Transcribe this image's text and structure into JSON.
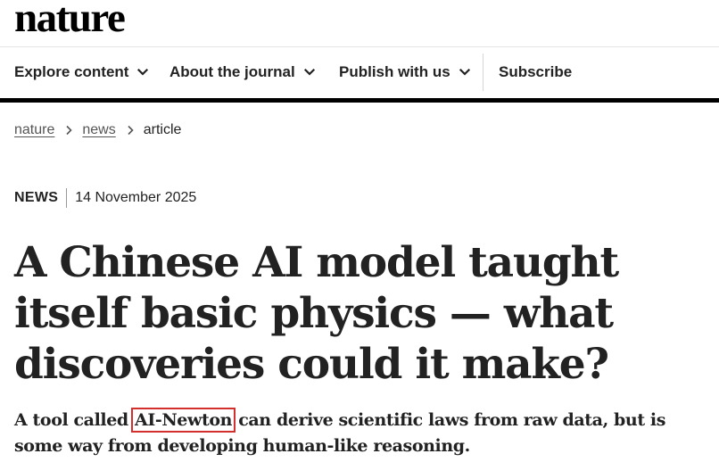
{
  "site": {
    "logo": "nature"
  },
  "nav": {
    "items": [
      {
        "label": "Explore content"
      },
      {
        "label": "About the journal"
      },
      {
        "label": "Publish with us"
      }
    ],
    "subscribe_label": "Subscribe",
    "chevron_icon": "chevron-down-icon"
  },
  "breadcrumb": {
    "items": [
      {
        "label": "nature"
      },
      {
        "label": "news"
      }
    ],
    "current": "article",
    "separator_icon": "chevron-right-icon"
  },
  "article": {
    "type": "NEWS",
    "date": "14 November 2025",
    "title": "A Chinese AI model taught itself basic physics — what discoveries could it make?",
    "standfirst": {
      "before": "A tool called ",
      "highlight": "AI-Newton",
      "after": " can derive scientific laws from raw data, but is some way from developing human-like reasoning."
    },
    "highlight_color": "#d32f2f"
  }
}
